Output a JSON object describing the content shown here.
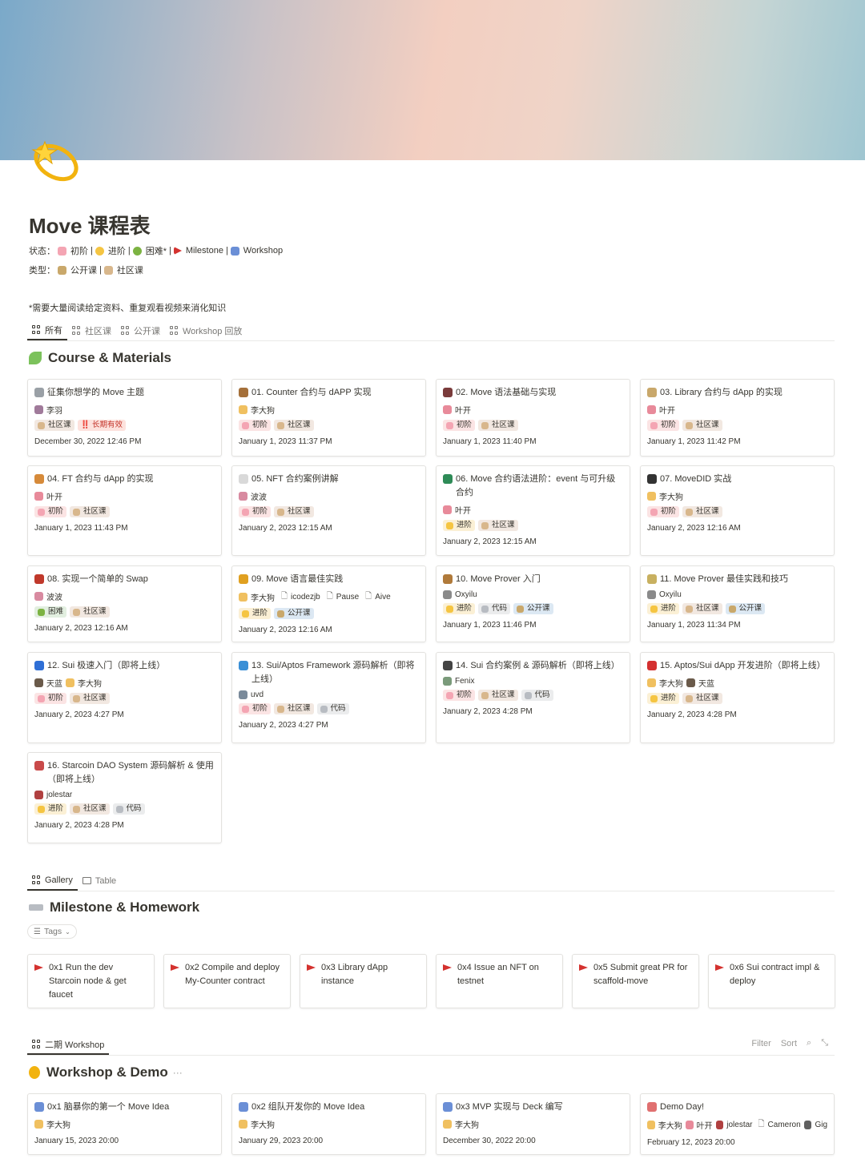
{
  "page": {
    "title": "Move 课程表",
    "status_label": "状态：",
    "status_items": [
      "初阶",
      "进阶",
      "困难*",
      "Milestone",
      "Workshop"
    ],
    "type_label": "类型：",
    "type_items": [
      "公开课",
      "社区课"
    ],
    "note": "*需要大量阅读给定资料、重复观看视频来消化知识"
  },
  "course_tabs": [
    "所有",
    "社区课",
    "公开课",
    "Workshop 回放"
  ],
  "course_section": {
    "title": "Course & Materials",
    "cards": [
      {
        "title": "征集你想学的 Move 主题",
        "icon": "infinity-icon",
        "people": [
          "李羽"
        ],
        "files": [],
        "tags": [
          "社区课",
          "‼️ 长期有效"
        ],
        "tag_styles": [
          "brown",
          "red"
        ],
        "date": "December 30, 2022 12:46 PM"
      },
      {
        "title": "01. Counter 合约与 dAPP 实现",
        "icon": "coconut-icon",
        "people": [
          "李大狗"
        ],
        "files": [],
        "tags": [
          "初阶",
          "社区课"
        ],
        "tag_styles": [
          "pink",
          "brown"
        ],
        "date": "January 1, 2023 11:37 PM"
      },
      {
        "title": "02. Move 语法基础与实现",
        "icon": "fireworks-icon",
        "people": [
          "叶开"
        ],
        "files": [],
        "tags": [
          "初阶",
          "社区课"
        ],
        "tag_styles": [
          "pink",
          "brown"
        ],
        "date": "January 1, 2023 11:40 PM"
      },
      {
        "title": "03. Library 合约与 dApp 的实现",
        "icon": "bow-icon",
        "people": [
          "叶开"
        ],
        "files": [],
        "tags": [
          "初阶",
          "社区课"
        ],
        "tag_styles": [
          "pink",
          "brown"
        ],
        "date": "January 1, 2023 11:42 PM"
      },
      {
        "title": "04. FT 合约与 dApp 的实现",
        "icon": "food-icon",
        "people": [
          "叶开"
        ],
        "files": [],
        "tags": [
          "初阶",
          "社区课"
        ],
        "tag_styles": [
          "pink",
          "brown"
        ],
        "date": "January 1, 2023 11:43 PM"
      },
      {
        "title": "05. NFT 合约案例讲解",
        "icon": "cloud-icon",
        "people": [
          "波波"
        ],
        "files": [],
        "tags": [
          "初阶",
          "社区课"
        ],
        "tag_styles": [
          "pink",
          "brown"
        ],
        "date": "January 2, 2023 12:15 AM"
      },
      {
        "title": "06. Move 合约语法进阶：event 与可升级合约",
        "icon": "flag-icon",
        "people": [
          "叶开"
        ],
        "files": [],
        "tags": [
          "进阶",
          "社区课"
        ],
        "tag_styles": [
          "yellow",
          "brown"
        ],
        "date": "January 2, 2023 12:15 AM"
      },
      {
        "title": "07. MoveDID 实战",
        "icon": "club-icon",
        "people": [
          "李大狗"
        ],
        "files": [],
        "tags": [
          "初阶",
          "社区课"
        ],
        "tag_styles": [
          "pink",
          "brown"
        ],
        "date": "January 2, 2023 12:16 AM"
      },
      {
        "title": "08. 实现一个简单的 Swap",
        "icon": "bowl-icon",
        "people": [
          "波波"
        ],
        "files": [],
        "tags": [
          "困难",
          "社区课"
        ],
        "tag_styles": [
          "green",
          "brown"
        ],
        "date": "January 2, 2023 12:16 AM"
      },
      {
        "title": "09. Move 语言最佳实践",
        "icon": "bell-icon",
        "people": [
          "李大狗"
        ],
        "files": [
          "icodezjb",
          "Pause",
          "Aive"
        ],
        "tags": [
          "进阶",
          "公开课"
        ],
        "tag_styles": [
          "yellow",
          "blue"
        ],
        "date": "January 2, 2023 12:16 AM"
      },
      {
        "title": "10. Move Prover 入门",
        "icon": "scale-icon",
        "people": [
          "Oxyilu"
        ],
        "files": [],
        "tags": [
          "进阶",
          "代码",
          "公开课"
        ],
        "tag_styles": [
          "yellow",
          "gray",
          "blue"
        ],
        "date": "January 1, 2023 11:46 PM"
      },
      {
        "title": "11. Move Prover 最佳实践和技巧",
        "icon": "bottle-icon",
        "people": [
          "Oxyilu"
        ],
        "files": [],
        "tags": [
          "进阶",
          "社区课",
          "公开课"
        ],
        "tag_styles": [
          "yellow",
          "brown",
          "blue"
        ],
        "date": "January 1, 2023 11:34 PM"
      },
      {
        "title": "12. Sui 极速入门（即将上线）",
        "icon": "cap-icon",
        "people": [
          "天蓝",
          "李大狗"
        ],
        "files": [],
        "tags": [
          "初阶",
          "社区课"
        ],
        "tag_styles": [
          "pink",
          "brown"
        ],
        "date": "January 2, 2023 4:27 PM"
      },
      {
        "title": "13. Sui/Aptos Framework 源码解析（即将上线）",
        "icon": "swimmer-icon",
        "people": [
          "uvd"
        ],
        "files": [],
        "tags": [
          "初阶",
          "社区课",
          "代码"
        ],
        "tag_styles": [
          "pink",
          "brown",
          "gray"
        ],
        "date": "January 2, 2023 4:27 PM"
      },
      {
        "title": "14. Sui 合约案例 & 源码解析（即将上线）",
        "icon": "piano-icon",
        "people": [
          "Fenix"
        ],
        "files": [],
        "tags": [
          "初阶",
          "社区课",
          "代码"
        ],
        "tag_styles": [
          "pink",
          "brown",
          "gray"
        ],
        "date": "January 2, 2023 4:28 PM"
      },
      {
        "title": "15. Aptos/Sui dApp 开发进阶（即将上线）",
        "icon": "firecracker-icon",
        "people": [
          "李大狗",
          "天蓝"
        ],
        "files": [],
        "tags": [
          "进阶",
          "社区课"
        ],
        "tag_styles": [
          "yellow",
          "brown"
        ],
        "date": "January 2, 2023 4:28 PM"
      },
      {
        "title": "16. Starcoin DAO System 源码解析 & 使用（即将上线）",
        "icon": "shield-icon",
        "people": [
          "jolestar"
        ],
        "files": [],
        "tags": [
          "进阶",
          "社区课",
          "代码"
        ],
        "tag_styles": [
          "yellow",
          "brown",
          "gray"
        ],
        "date": "January 2, 2023 4:28 PM"
      }
    ]
  },
  "milestone_tabs": [
    "Gallery",
    "Table"
  ],
  "milestone_section": {
    "title": "Milestone & Homework",
    "filter_pill": "Tags",
    "cards": [
      "0x1 Run the dev Starcoin node & get faucet",
      "0x2 Compile and deploy My-Counter contract",
      "0x3 Library dApp instance",
      "0x4 Issue an NFT on testnet",
      "0x5 Submit great PR for scaffold-move",
      "0x6 Sui contract impl & deploy"
    ]
  },
  "workshop_tabs": [
    "二期 Workshop"
  ],
  "workshop_toolbar": {
    "filter": "Filter",
    "sort": "Sort"
  },
  "workshop_section": {
    "title": "Workshop & Demo",
    "more": "···",
    "cards": [
      {
        "title": "0x1 脑暴你的第一个 Move Idea",
        "icon": "rocket-icon",
        "people": [
          "李大狗"
        ],
        "files": [],
        "date": "January 15, 2023 20:00"
      },
      {
        "title": "0x2 组队开发你的 Move Idea",
        "icon": "rocket-icon",
        "people": [
          "李大狗"
        ],
        "files": [],
        "date": "January 29, 2023 20:00"
      },
      {
        "title": "0x3 MVP 实现与 Deck 编写",
        "icon": "rocket-icon",
        "people": [
          "李大狗"
        ],
        "files": [],
        "date": "December 30, 2022 20:00"
      },
      {
        "title": "Demo Day!",
        "icon": "calendar-icon",
        "people": [
          "李大狗",
          "叶开",
          "jolestar"
        ],
        "files": [
          "Cameron"
        ],
        "extra_people": [
          "Gig"
        ],
        "date": "February 12, 2023 20:00"
      }
    ]
  },
  "colors": {
    "accent": "#37352f",
    "muted": "#787774",
    "flag": "#d4322f",
    "border": "#e3e2df"
  }
}
